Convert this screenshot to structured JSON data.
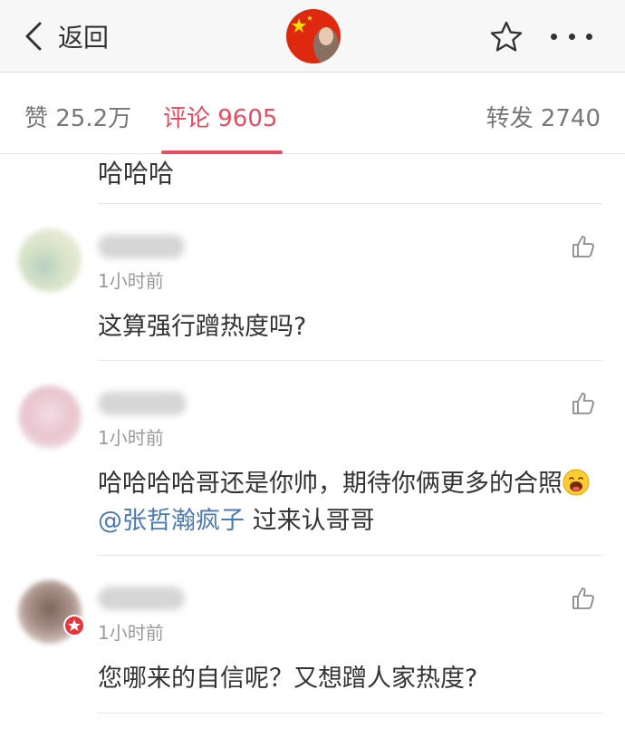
{
  "nav": {
    "back_label": "返回"
  },
  "tabs": {
    "likes": "赞 25.2万",
    "comments": "评论 9605",
    "reposts": "转发 2740"
  },
  "prev_comment": {
    "text": "哈哈哈"
  },
  "comments": [
    {
      "time": "1小时前",
      "text": "这算强行蹭热度吗?"
    },
    {
      "time": "1小时前",
      "text_part1": "哈哈哈哈哥还是你帅，期待你俩更多的合照",
      "mention": "@张哲瀚疯子",
      "text_part2": " 过来认哥哥"
    },
    {
      "time": "1小时前",
      "text": "您哪来的自信呢？又想蹭人家热度?"
    }
  ],
  "colors": {
    "accent": "#e84a5f",
    "mention": "#4a7ab4",
    "nav_bg": "#f7f7f7"
  }
}
